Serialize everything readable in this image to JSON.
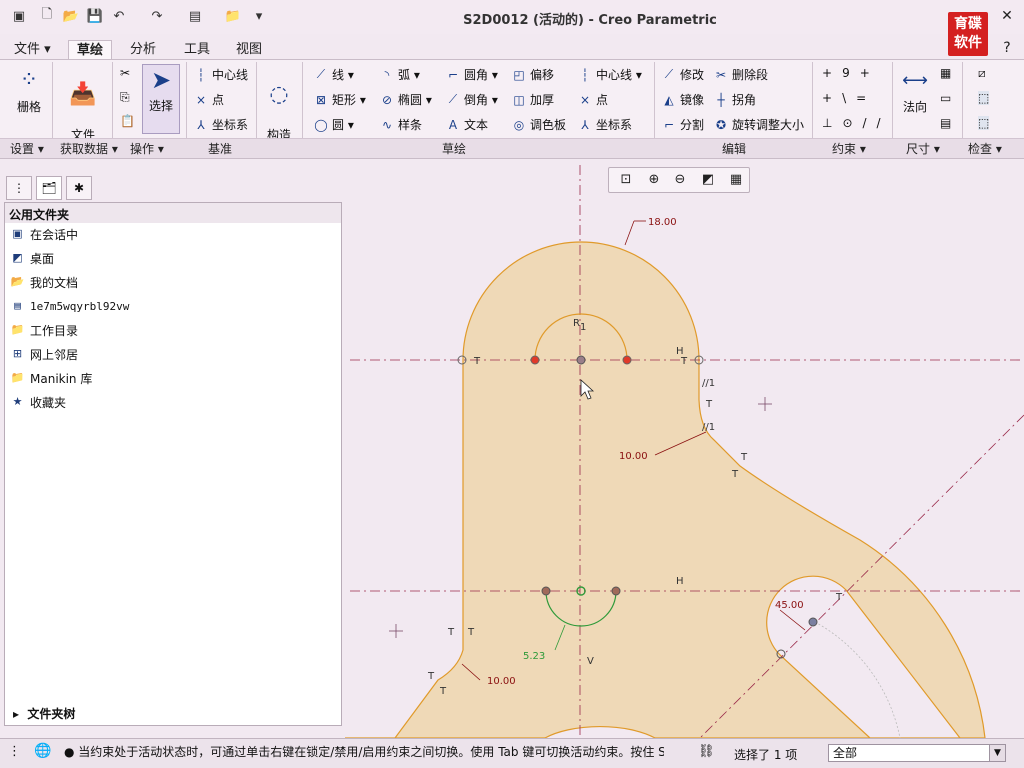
{
  "window": {
    "title": "S2D0012 (活动的) - Creo Parametric"
  },
  "logo": {
    "line1": "育碟",
    "line2": "软件"
  },
  "menu": {
    "items": [
      "文件",
      "草绘",
      "分析",
      "工具",
      "视图"
    ]
  },
  "ribbon": {
    "setup": {
      "grid_label": "栅格"
    },
    "get_data": {
      "file_system_label": "文件\n系统"
    },
    "operations": {
      "select_label": "选择"
    },
    "datum": {
      "centerline": "中心线",
      "point": "点",
      "coordsys": "坐标系"
    },
    "construct": {
      "label": "构造\n模式"
    },
    "sketch": {
      "line": "线",
      "arc": "弧",
      "fillet": "圆角",
      "offset": "偏移",
      "rectangle": "矩形",
      "ellipse": "椭圆",
      "chamfer": "倒角",
      "thicken": "加厚",
      "circle": "圆",
      "spline": "样条",
      "text": "文本",
      "palette": "调色板",
      "centerline": "中心线",
      "point": "点",
      "coordsys": "坐标系"
    },
    "edit": {
      "modify": "修改",
      "delete_segment": "删除段",
      "mirror": "镜像",
      "corner": "拐角",
      "divide": "分割",
      "rotate_resize": "旋转调整大小"
    },
    "dimension": {
      "normal_label": "法向"
    },
    "groups": [
      "设置",
      "获取数据",
      "操作",
      "基准",
      "草绘",
      "编辑",
      "约束",
      "尺寸",
      "检查"
    ]
  },
  "navigator": {
    "header": "公用文件夹",
    "items": [
      {
        "label": "在会话中",
        "icon": "monitor-icon"
      },
      {
        "label": "桌面",
        "icon": "desktop-icon"
      },
      {
        "label": "我的文档",
        "icon": "folder-open-icon"
      },
      {
        "label": "1e7m5wqyrbl92vw",
        "icon": "computer-icon"
      },
      {
        "label": "工作目录",
        "icon": "folder-star-icon"
      },
      {
        "label": "网上邻居",
        "icon": "network-icon"
      },
      {
        "label": "Manikin 库",
        "icon": "folder-icon"
      },
      {
        "label": "收藏夹",
        "icon": "favorites-icon"
      }
    ],
    "tree_label": "文件夹树"
  },
  "canvas": {
    "dims": {
      "top_radius": "18.00",
      "fillet_right": "10.00",
      "fillet_left": "10.00",
      "angle": "45.00",
      "small_arc": "5.23"
    },
    "labels": {
      "r1": "R",
      "r1_sub": "1",
      "h1": "H",
      "h2": "H",
      "v": "V",
      "par1": "//1",
      "par2": "//1",
      "t": "T"
    }
  },
  "status": {
    "message": "● 当约束处于活动状态时，可通过单击右键在锁定/禁用/启用约束之间切换。使用 Tab 键可切换活动约束。按住 Shift",
    "selected": "选择了 1 项",
    "filter": "全部"
  },
  "colors": {
    "accent": "#1a3f8a",
    "part_fill": "#efd9b7",
    "part_edge": "#e09a2a",
    "dim_text": "#8a1010",
    "axis_line": "#9a2a4a"
  }
}
